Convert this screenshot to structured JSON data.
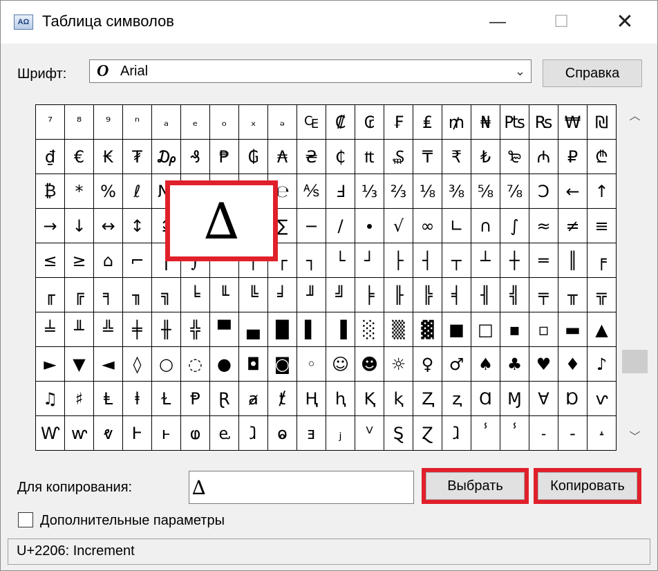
{
  "window": {
    "title": "Таблица символов",
    "icon_name": "charmap-icon",
    "min_glyph": "—",
    "max_glyph": "☐",
    "close_glyph": "✕"
  },
  "font": {
    "label": "Шрифт:",
    "glyph": "O",
    "value": "Arial",
    "chevron": "⌄"
  },
  "help_label": "Справка",
  "grid": {
    "rows": [
      [
        "⁷",
        "⁸",
        "⁹",
        "ⁿ",
        "ₐ",
        "ₑ",
        "ₒ",
        "ₓ",
        "ₔ",
        "₠",
        "₡",
        "₢",
        "₣",
        "₤",
        "₥",
        "₦",
        "₧",
        "₨",
        "₩",
        "₪"
      ],
      [
        "₫",
        "€",
        "₭",
        "₮",
        "₯",
        "₰",
        "₱",
        "₲",
        "₳",
        "₴",
        "₵",
        "₶",
        "₷",
        "₸",
        "₹",
        "₺",
        "₻",
        "₼",
        "₽",
        "₾"
      ],
      [
        "₿",
        "*",
        "%",
        "ℓ",
        "№",
        "℗",
        "™",
        "Ω",
        "℮",
        "⅍",
        "Ⅎ",
        "⅓",
        "⅔",
        "⅛",
        "⅜",
        "⅝",
        "⅞",
        "Ↄ",
        "←",
        "↑"
      ],
      [
        "→",
        "↓",
        "↔",
        "↕",
        "↨",
        "∂",
        "∆",
        "∏",
        "∑",
        "−",
        "∕",
        "∙",
        "√",
        "∞",
        "∟",
        "∩",
        "∫",
        "≈",
        "≠",
        "≡"
      ],
      [
        "≤",
        "≥",
        "⌂",
        "⌐",
        "⌠",
        "⌡",
        "─",
        "│",
        "┌",
        "┐",
        "└",
        "┘",
        "├",
        "┤",
        "┬",
        "┴",
        "┼",
        "═",
        "║",
        "╒"
      ],
      [
        "╓",
        "╔",
        "╕",
        "╖",
        "╗",
        "╘",
        "╙",
        "╚",
        "╛",
        "╜",
        "╝",
        "╞",
        "╟",
        "╠",
        "╡",
        "╢",
        "╣",
        "╤",
        "╥",
        "╦"
      ],
      [
        "╧",
        "╨",
        "╩",
        "╪",
        "╫",
        "╬",
        "▀",
        "▄",
        "█",
        "▌",
        "▐",
        "░",
        "▒",
        "▓",
        "■",
        "□",
        "▪",
        "▫",
        "▬",
        "▲"
      ],
      [
        "►",
        "▼",
        "◄",
        "◊",
        "○",
        "◌",
        "●",
        "◘",
        "◙",
        "◦",
        "☺",
        "☻",
        "☼",
        "♀",
        "♂",
        "♠",
        "♣",
        "♥",
        "♦",
        "♪"
      ],
      [
        "♫",
        "♯",
        "Ⱡ",
        "ⱡ",
        "Ɫ",
        "Ᵽ",
        "Ɽ",
        "ⱥ",
        "ⱦ",
        "Ⱨ",
        "ⱨ",
        "Ⱪ",
        "ⱪ",
        "Ⱬ",
        "ⱬ",
        "Ɑ",
        "Ɱ",
        "Ɐ",
        "Ɒ",
        "ⱱ"
      ],
      [
        "Ⱳ",
        "ⱳ",
        "ⱴ",
        "Ⱶ",
        "ⱶ",
        "ⱷ",
        "ⱸ",
        "ⱹ",
        "ⱺ",
        "ⱻ",
        "ⱼ",
        "ⱽ",
        "Ȿ",
        "Ɀ",
        "ⱹ",
        "ⸯ",
        "ⸯ",
        "˗",
        "-",
        "˔"
      ]
    ],
    "selected_glyph": "∆"
  },
  "copy": {
    "label": "Для копирования:",
    "value": "∆",
    "select_label": "Выбрать",
    "copy_label": "Копировать"
  },
  "advanced": {
    "label": "Дополнительные параметры",
    "checked": false
  },
  "status": {
    "text": "U+2206: Increment"
  },
  "colors": {
    "highlight": "#e0202a",
    "window_bg": "#f0f0f0"
  }
}
